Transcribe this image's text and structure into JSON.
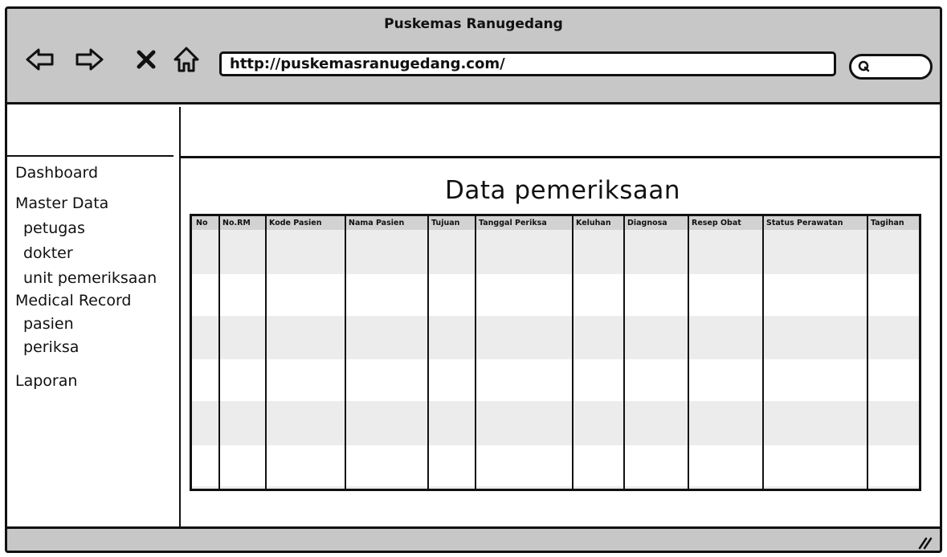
{
  "window": {
    "title": "Puskemas Ranugedang"
  },
  "toolbar": {
    "back_icon": "arrow-left-icon",
    "forward_icon": "arrow-right-icon",
    "stop_icon": "close-icon",
    "home_icon": "home-icon",
    "url": "http://puskemasranugedang.com/",
    "search_icon": "search-icon"
  },
  "sidebar": {
    "items": [
      {
        "label": "Dashboard",
        "level": 0
      },
      {
        "label": "Master Data",
        "level": 0
      },
      {
        "label": "petugas",
        "level": 1
      },
      {
        "label": "dokter",
        "level": 1
      },
      {
        "label": "unit pemeriksaan",
        "level": 1
      },
      {
        "label": "Medical Record",
        "level": 0
      },
      {
        "label": "pasien",
        "level": 1
      },
      {
        "label": "periksa",
        "level": 1
      },
      {
        "label": "Laporan",
        "level": 0
      }
    ]
  },
  "main": {
    "title": "Data pemeriksaan",
    "table": {
      "columns": [
        "No",
        "No.RM",
        "Kode Pasien",
        "Nama Pasien",
        "Tujuan",
        "Tanggal Periksa",
        "Keluhan",
        "Diagnosa",
        "Resep Obat",
        "Status Perawatan",
        "Tagihan"
      ],
      "rows": []
    }
  },
  "colors": {
    "chrome": "#c7c7c7",
    "stripe": "#ececec",
    "header": "#d2d2d2",
    "ink": "#111111"
  }
}
